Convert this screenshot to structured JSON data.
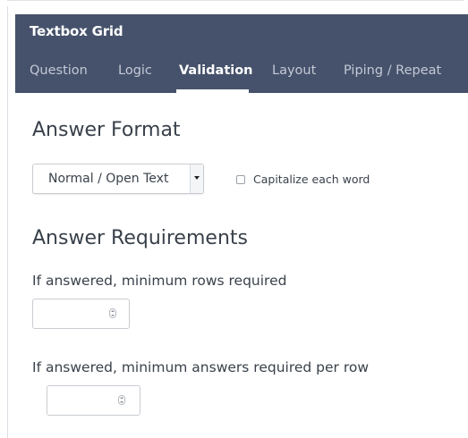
{
  "header": {
    "title": "Textbox Grid",
    "tabs": [
      {
        "label": "Question",
        "active": false
      },
      {
        "label": "Logic",
        "active": false
      },
      {
        "label": "Validation",
        "active": true
      },
      {
        "label": "Layout",
        "active": false
      },
      {
        "label": "Piping / Repeat",
        "active": false
      }
    ]
  },
  "answer_format": {
    "heading": "Answer Format",
    "format_select_value": "Normal / Open Text",
    "capitalize_label": "Capitalize each word",
    "capitalize_checked": false
  },
  "answer_requirements": {
    "heading": "Answer Requirements",
    "min_rows_label": "If answered, minimum rows required",
    "min_rows_value": "",
    "min_answers_label": "If answered, minimum answers required per row",
    "min_answers_value": ""
  },
  "colors": {
    "header_bg": "#46526b",
    "active_tab": "#ffffff",
    "inactive_tab": "#c3c9d6"
  }
}
